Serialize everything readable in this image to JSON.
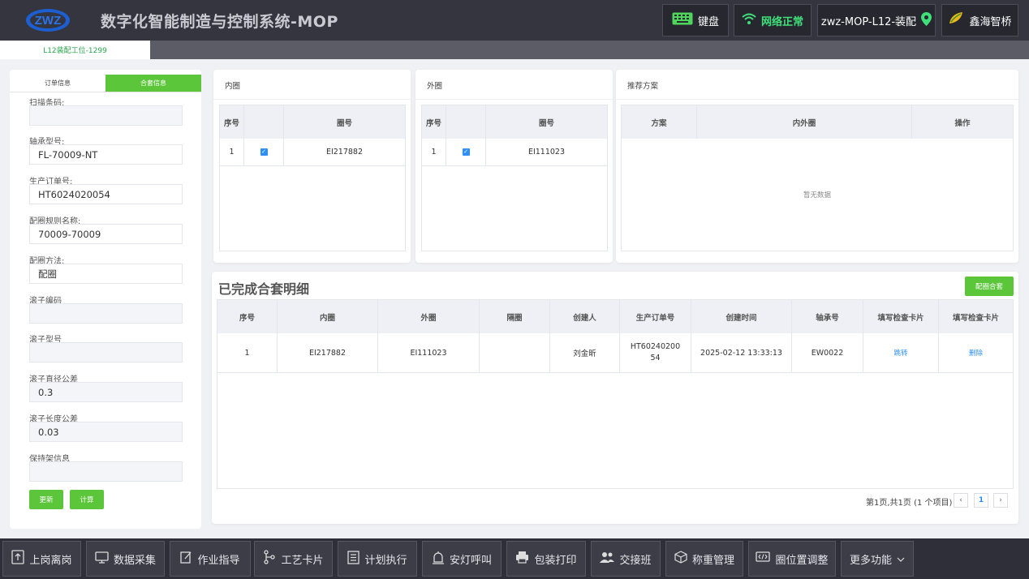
{
  "header": {
    "title": "数字化智能制造与控制系统-MOP",
    "logo_text": "ZWZ",
    "keyboard_label": "键盘",
    "network_label": "网络正常",
    "station_label": "zwz-MOP-L12-装配",
    "brand_label": "鑫海智桥"
  },
  "tabs": {
    "active": "L12装配工位-1299"
  },
  "left": {
    "tab_order": "订单信息",
    "tab_match": "合套信息",
    "fields": [
      {
        "label": "扫描条码:",
        "value": ""
      },
      {
        "label": "轴承型号:",
        "value": "FL-70009-NT"
      },
      {
        "label": "生产订单号:",
        "value": "HT6024020054"
      },
      {
        "label": "配圈规则名称:",
        "value": "70009-70009"
      },
      {
        "label": "配圈方法:",
        "value": "配圈"
      },
      {
        "label": "滚子编码",
        "value": ""
      },
      {
        "label": "滚子型号",
        "value": ""
      },
      {
        "label": "滚子直径公差",
        "value": "0.3"
      },
      {
        "label": "滚子长度公差",
        "value": "0.03"
      },
      {
        "label": "保持架信息",
        "value": ""
      }
    ],
    "update_button": "更新",
    "calc_button": "计算"
  },
  "inner": {
    "title": "内圈",
    "headers": [
      "序号",
      "",
      "圈号"
    ],
    "rows": [
      {
        "no": "1",
        "ring": "EI217882"
      }
    ]
  },
  "outer": {
    "title": "外圈",
    "headers": [
      "序号",
      "",
      "圈号"
    ],
    "rows": [
      {
        "no": "1",
        "ring": "EI111023"
      }
    ]
  },
  "recommend": {
    "title": "推荐方案",
    "headers": [
      "方案",
      "内外圈",
      "操作"
    ],
    "empty": "暂无数据"
  },
  "completed": {
    "title": "已完成合套明细",
    "match_button": "配圈合套",
    "headers": [
      "序号",
      "内圈",
      "外圈",
      "隔圈",
      "创建人",
      "生产订单号",
      "创建时间",
      "轴承号",
      "填写检查卡片",
      "填写检查卡片"
    ],
    "rows": [
      {
        "no": "1",
        "inner": "EI217882",
        "outer": "EI111023",
        "spacer": "",
        "creator": "刘金昕",
        "order": "HT6024020054",
        "time": "2025-02-12 13:33:13",
        "bearing": "EW0022",
        "action1": "跳转",
        "action2": "删除"
      }
    ],
    "pager": {
      "summary": "第1页,共1页 (1 个项目)",
      "prev": "‹",
      "page": "1",
      "next": "›"
    }
  },
  "bottom_nav": [
    {
      "label": "上岗离岗",
      "icon": "upload-icon"
    },
    {
      "label": "数据采集",
      "icon": "monitor-icon"
    },
    {
      "label": "作业指导",
      "icon": "edit-icon"
    },
    {
      "label": "工艺卡片",
      "icon": "flow-icon"
    },
    {
      "label": "计划执行",
      "icon": "list-icon"
    },
    {
      "label": "安灯呼叫",
      "icon": "alarm-icon"
    },
    {
      "label": "包装打印",
      "icon": "printer-icon"
    },
    {
      "label": "交接班",
      "icon": "users-icon"
    },
    {
      "label": "称重管理",
      "icon": "box-icon"
    },
    {
      "label": "圈位置调整",
      "icon": "code-icon"
    },
    {
      "label": "更多功能",
      "icon": "chevron-down-icon"
    }
  ]
}
